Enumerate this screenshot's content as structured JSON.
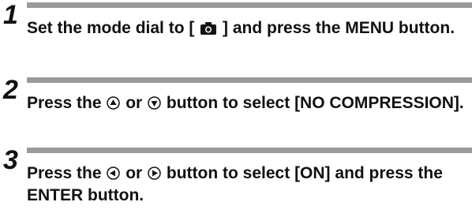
{
  "steps": [
    {
      "number": "1",
      "text_before": "Set the mode dial to [ ",
      "icon": "camera-icon",
      "text_after": " ] and press the MENU button."
    },
    {
      "number": "2",
      "text_before": "Press the ",
      "icon_a": "up-arrow-button-icon",
      "text_middle": " or ",
      "icon_b": "down-arrow-button-icon",
      "text_after": " button to select [NO COMPRESSION]."
    },
    {
      "number": "3",
      "text_before": "Press the ",
      "icon_a": "left-arrow-button-icon",
      "text_middle": " or ",
      "icon_b": "right-arrow-button-icon",
      "text_after": " button to select [ON] and press the ENTER button."
    }
  ],
  "colors": {
    "bar": "#9a9a9a",
    "text": "#111111"
  }
}
